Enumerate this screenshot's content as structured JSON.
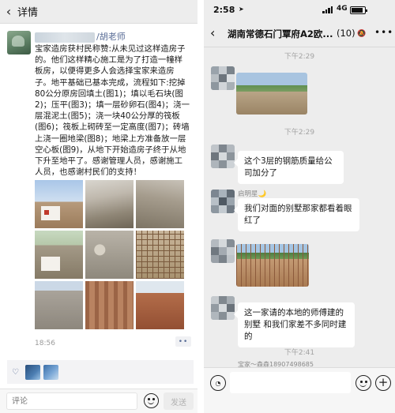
{
  "left": {
    "header": {
      "back_icon": "chevron-left-icon",
      "title": "详情"
    },
    "post": {
      "author_suffix": "/胡老师",
      "text": "宝家造房获村民称赞:从未见过这样造房子的。他们这样精心施工是为了打造一幢样板房，以便得更多人会选择宝家来造房子。地平基础已基本完成，流程如下:挖掉80公分原房回填土(图1)；填以毛石块(图2)；压平(图3)；填一层砂卵石(图4)；浇一层混泥土(图5)；浇一块40公分厚的筏板(图6)；筏板上砌砖至一定高度(图7)；砖墙上浇一圈地梁(图8)；地梁上方准备放一层空心板(图9)，从地下开始造房子终于从地下升至地平了。感谢管理人员，感谢施工人员，也感谢村民们的支持！",
      "photos": [
        "图1",
        "图2",
        "图3",
        "图4",
        "图5",
        "图6",
        "图7",
        "图8",
        "图9"
      ],
      "time": "18:56",
      "more_button": "••",
      "like_icon": "heart-icon"
    },
    "comment": {
      "placeholder": "评论",
      "send_label": "发送",
      "emoji_icon": "smiley-icon"
    }
  },
  "right": {
    "status": {
      "time": "2:58",
      "network": "4G"
    },
    "chat": {
      "title": "湖南常德石门覃府A2欧...",
      "count": "(10)",
      "timestamps": [
        "下午2:29",
        "下午2:29",
        "下午2:41"
      ],
      "messages": [
        {
          "type": "image"
        },
        {
          "type": "text",
          "text": "这个3层的钢筋质量给公司加分了"
        },
        {
          "type": "text",
          "sender": "启明星🌙",
          "text": "我们对面的别墅那家都看着眼红了"
        },
        {
          "type": "image"
        },
        {
          "type": "text",
          "text": "这一家请的本地的师傅建的别墅 和我们家差不多同时建的"
        }
      ],
      "partial_sender": "宝家～森森18907498685"
    },
    "input": {
      "voice_icon": "voice-icon",
      "emoji_icon": "smiley-icon",
      "plus_icon": "plus-icon"
    }
  },
  "colors": {
    "link_blue": "#576b95",
    "chat_bg": "#ededed",
    "bubble": "#ffffff"
  }
}
